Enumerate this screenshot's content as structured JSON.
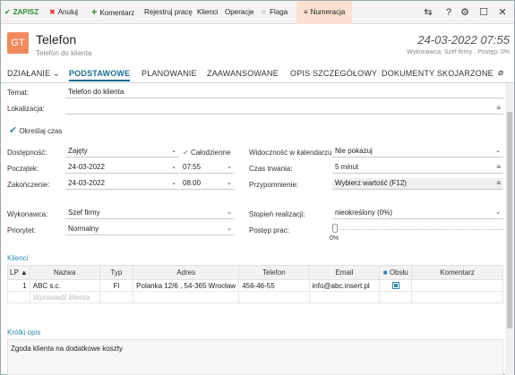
{
  "toolbar": {
    "save": "ZAPISZ",
    "cancel": "Anuluj",
    "comment": "Komentarz",
    "register": "Rejestruj pracę",
    "clients": "Klienci",
    "operations": "Operacje",
    "flag": "Flaga",
    "numbering": "Numeracja"
  },
  "header": {
    "avatar": "GT",
    "title": "Telefon",
    "subtitle": "Telefon do klienta",
    "date": "24-03-2022 07:55",
    "meta": "Wykonawca: Szef firmy  ·  Postęp: 0%"
  },
  "tabs": [
    "DZIAŁANIE",
    "PODSTAWOWE",
    "PLANOWANIE",
    "ZAAWANSOWANE",
    "OPIS SZCZEGÓŁOWY",
    "DOKUMENTY SKOJARZONE"
  ],
  "form": {
    "temat_label": "Temat:",
    "temat_value": "Telefon do klienta",
    "lokalizacja_label": "Lokalizacja:",
    "lokalizacja_value": "",
    "okresl_czas": "Określaj czas",
    "dostepnosc_label": "Dostępność:",
    "dostepnosc_value": "Zajęty",
    "calodzienne": "Całodzienne",
    "poczatek_label": "Początek:",
    "poczatek_date": "24-03-2022",
    "poczatek_time": "07:55",
    "zakonczenie_label": "Zakończenie:",
    "zakonczenie_date": "24-03-2022",
    "zakonczenie_time": "08:00",
    "widocznosc_label": "Widoczność w kalendarzu:",
    "widocznosc_value": "Nie pokazuj",
    "czas_trwania_label": "Czas trwania:",
    "czas_trwania_value": "5 minut",
    "przypomnienie_label": "Przypomnienie:",
    "przypomnienie_value": "Wybierz wartość (F12)",
    "wykonawca_label": "Wykonawca:",
    "wykonawca_value": "Szef firmy",
    "priorytet_label": "Priorytet:",
    "priorytet_value": "Normalny",
    "stopien_label": "Stopień realizacji:",
    "stopien_value": "nieokreślony  (0%)",
    "postep_label": "Postęp prac:",
    "postep_value": "0%",
    "postep_fraction": 0
  },
  "klienci": {
    "section": "Klienci",
    "columns": [
      "LP ▲",
      "Nazwa",
      "Typ",
      "Adres",
      "Telefon",
      "Email",
      "Obsłu",
      "Komentarz"
    ],
    "rows": [
      {
        "lp": "1",
        "nazwa": "ABC s.c.",
        "typ": "FI",
        "adres": "Polanka  12/6 , 54-365 Wrocław",
        "telefon": "456-46-55",
        "email": "info@abc.insert.pl",
        "komentarz": ""
      }
    ],
    "placeholder": "Wprowadź klienta"
  },
  "opis": {
    "section": "Krótki opis",
    "text": "Zgoda klienta na dodatkowe koszty"
  }
}
